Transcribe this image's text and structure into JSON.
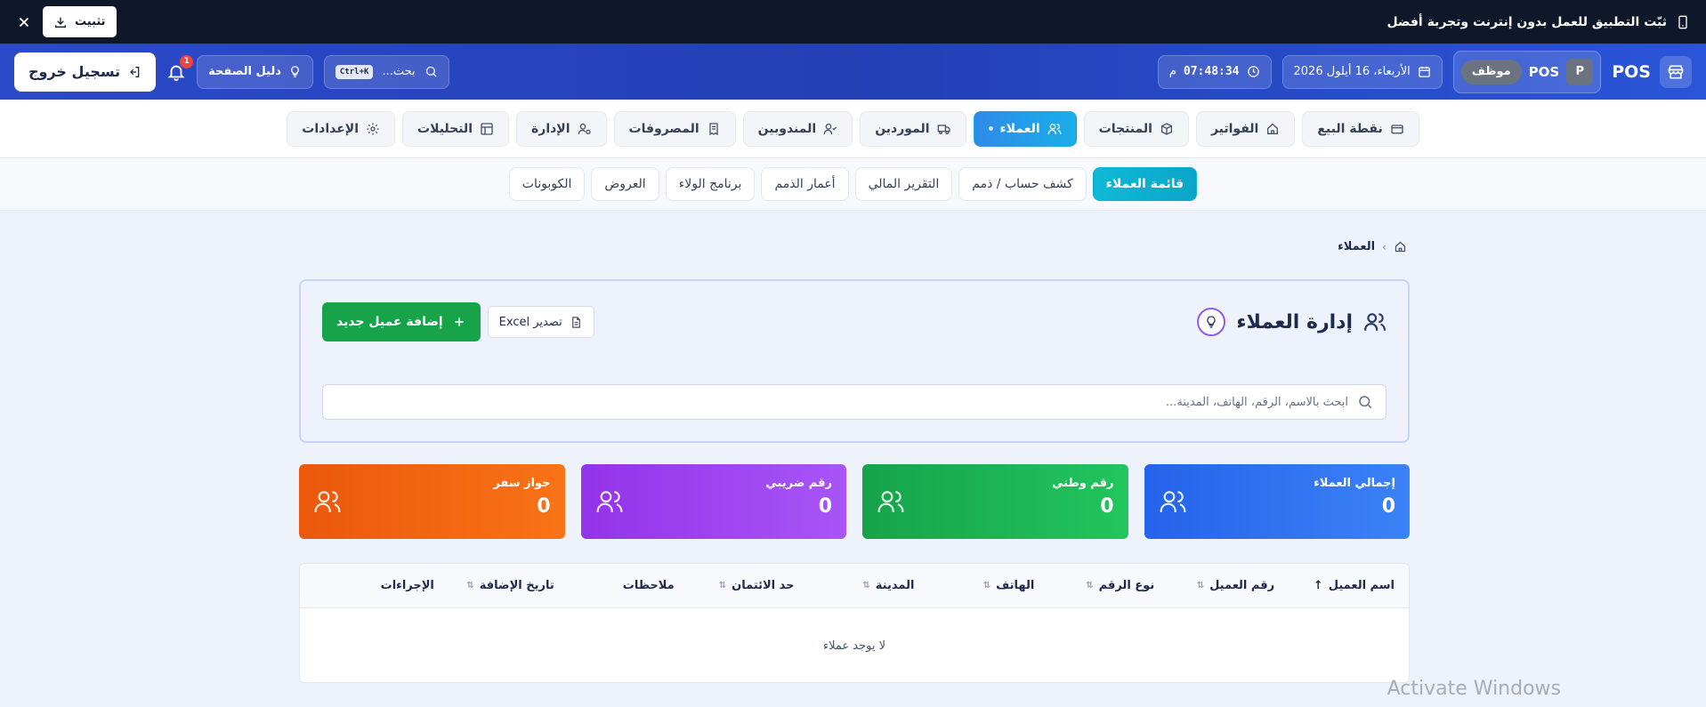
{
  "banner": {
    "message": "ثبّت التطبيق للعمل بدون إنترنت وتجربة أفضل",
    "install_label": "تثبيت",
    "icons": [
      "phone-icon",
      "download-icon",
      "close-icon"
    ]
  },
  "header": {
    "brand": "POS",
    "user_initial": "P",
    "user_name": "POS",
    "role": "موظف",
    "date": "الأربعاء، 16 أيلول 2026",
    "time": "07:48:34",
    "time_suffix": "م",
    "search_placeholder": "بحث...",
    "search_shortcut": "Ctrl+K",
    "guide_label": "دليل الصفحة",
    "notification_count": "1",
    "logout_label": "تسجيل خروج"
  },
  "main_nav": [
    {
      "label": "نقطة البيع",
      "icon": "credit-card-icon",
      "active": false
    },
    {
      "label": "الفواتير",
      "icon": "home-icon",
      "active": false
    },
    {
      "label": "المنتجات",
      "icon": "box-icon",
      "active": false
    },
    {
      "label": "العملاء",
      "icon": "users-icon",
      "active": true
    },
    {
      "label": "الموردين",
      "icon": "truck-icon",
      "active": false
    },
    {
      "label": "المندوبين",
      "icon": "user-check-icon",
      "active": false
    },
    {
      "label": "المصروفات",
      "icon": "receipt-icon",
      "active": false
    },
    {
      "label": "الإدارة",
      "icon": "admin-icon",
      "active": false
    },
    {
      "label": "التحليلات",
      "icon": "analytics-icon",
      "active": false
    },
    {
      "label": "الإعدادات",
      "icon": "gear-icon",
      "active": false
    }
  ],
  "sub_nav": [
    {
      "label": "قائمة العملاء",
      "active": true
    },
    {
      "label": "كشف حساب / ذمم",
      "active": false
    },
    {
      "label": "التقرير المالي",
      "active": false
    },
    {
      "label": "أعمار الذمم",
      "active": false
    },
    {
      "label": "برنامج الولاء",
      "active": false
    },
    {
      "label": "العروض",
      "active": false
    },
    {
      "label": "الكوبونات",
      "active": false
    }
  ],
  "breadcrumb": {
    "current": "العملاء"
  },
  "management": {
    "title": "إدارة العملاء",
    "add_label": "إضافة عميل جديد",
    "export_label": "تصدير Excel",
    "search_placeholder": "ابحث بالاسم، الرقم، الهاتف، المدينة...",
    "search_value": ""
  },
  "stats": [
    {
      "label": "إجمالي العملاء",
      "value": "0",
      "color": "#2563eb"
    },
    {
      "label": "رقم وطني",
      "value": "0",
      "color": "#16a34a"
    },
    {
      "label": "رقم ضريبي",
      "value": "0",
      "color": "#9333ea"
    },
    {
      "label": "جواز سفر",
      "value": "0",
      "color": "#ea580c"
    }
  ],
  "table": {
    "columns": [
      {
        "label": "اسم العميل",
        "sort": "asc"
      },
      {
        "label": "رقم العميل",
        "sort": "both"
      },
      {
        "label": "نوع الرقم",
        "sort": "both"
      },
      {
        "label": "الهاتف",
        "sort": "both"
      },
      {
        "label": "المدينة",
        "sort": "both"
      },
      {
        "label": "حد الائتمان",
        "sort": "both"
      },
      {
        "label": "ملاحظات",
        "sort": "none"
      },
      {
        "label": "تاريخ الإضافة",
        "sort": "both"
      },
      {
        "label": "الإجراءات",
        "sort": "none"
      }
    ],
    "empty_message": "لا يوجد عملاء"
  },
  "watermark": "Activate Windows"
}
